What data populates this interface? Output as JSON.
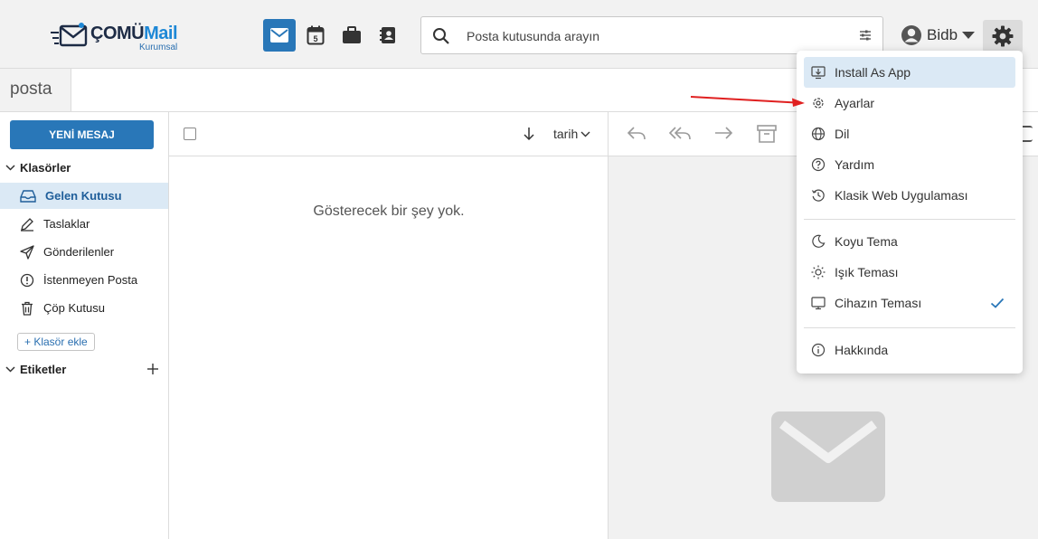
{
  "header": {
    "logo": {
      "part1": "ÇOMÜ",
      "part2": "Mail",
      "subtitle": "Kurumsal"
    },
    "apps": [
      "mail-icon",
      "calendar-icon",
      "briefcase-icon",
      "contacts-icon"
    ],
    "calendar_day": "5",
    "search": {
      "placeholder": "Posta kutusunda arayın",
      "value": ""
    },
    "user": {
      "name": "Bidb"
    }
  },
  "tab": {
    "label": "posta"
  },
  "sidebar": {
    "new_message": "YENİ MESAJ",
    "folders_header": "Klasörler",
    "folders": [
      {
        "label": "Gelen Kutusu",
        "icon": "inbox-icon",
        "active": true
      },
      {
        "label": "Taslaklar",
        "icon": "pencil-icon"
      },
      {
        "label": "Gönderilenler",
        "icon": "send-icon"
      },
      {
        "label": "İstenmeyen Posta",
        "icon": "spam-icon"
      },
      {
        "label": "Çöp Kutusu",
        "icon": "trash-icon"
      }
    ],
    "add_folder": "+ Klasör ekle",
    "labels_header": "Etiketler"
  },
  "list": {
    "sort_field": "tarih",
    "empty_text": "Gösterecek bir şey yok."
  },
  "menu": {
    "items": [
      {
        "label": "Install As App",
        "icon": "monitor-download-icon",
        "highlighted": true
      },
      {
        "label": "Ayarlar",
        "icon": "gear-icon"
      },
      {
        "label": "Dil",
        "icon": "globe-icon"
      },
      {
        "label": "Yardım",
        "icon": "help-icon"
      },
      {
        "label": "Klasik Web Uygulaması",
        "icon": "history-icon"
      },
      {
        "label": "Koyu Tema",
        "icon": "moon-icon"
      },
      {
        "label": "Işık Teması",
        "icon": "sun-icon"
      },
      {
        "label": "Cihazın Teması",
        "icon": "monitor-icon",
        "checked": true
      },
      {
        "label": "Hakkında",
        "icon": "info-icon"
      }
    ]
  },
  "colors": {
    "primary": "#2977b8",
    "active_bg": "#dbe9f5",
    "annotation_arrow": "#e02020"
  }
}
